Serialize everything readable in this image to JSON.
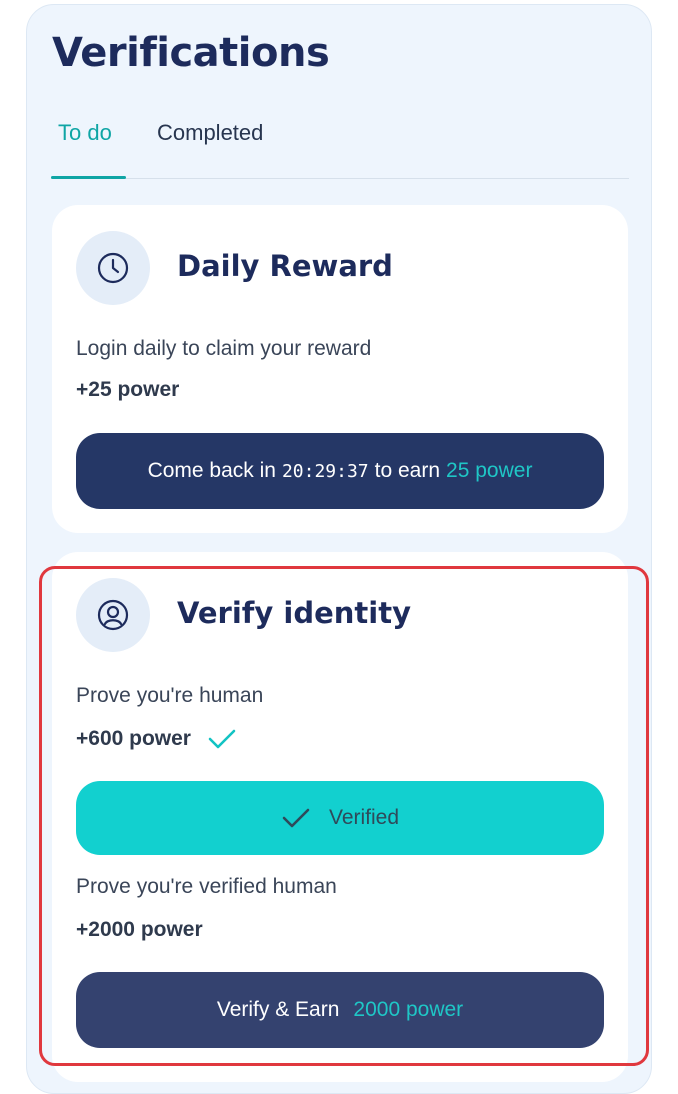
{
  "header": {
    "title": "Verifications"
  },
  "tabs": [
    {
      "label": "To do",
      "active": true
    },
    {
      "label": "Completed",
      "active": false
    }
  ],
  "daily_reward": {
    "icon": "clock-icon",
    "title": "Daily Reward",
    "description": "Login daily to claim your reward",
    "power": "+25 power",
    "button": {
      "prefix": "Come back in",
      "countdown": "20:29:37",
      "middle": "to earn",
      "accent": "25 power"
    }
  },
  "verify_identity": {
    "icon": "user-circle-icon",
    "title": "Verify identity",
    "human": {
      "description": "Prove you're human",
      "power": "+600 power",
      "verified_button": "Verified"
    },
    "verified_human": {
      "description": "Prove you're verified human",
      "power": "+2000 power",
      "button": {
        "label": "Verify & Earn",
        "accent": "2000 power"
      }
    }
  },
  "colors": {
    "navy": "#1d2b5c",
    "teal": "#12d0cf",
    "accent_text": "#1fc6c6",
    "highlight_border": "#e0383e",
    "panel_bg": "#eef5fd"
  }
}
